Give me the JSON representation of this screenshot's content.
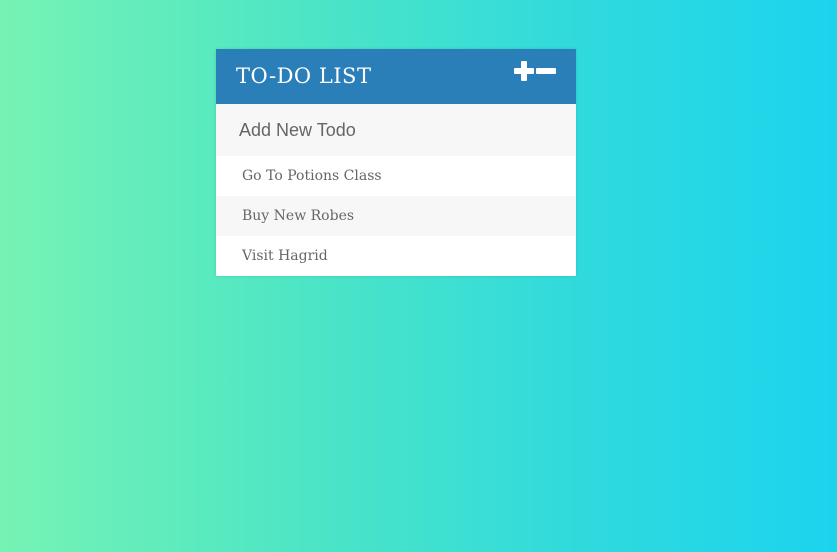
{
  "header": {
    "title": "TO-DO LIST",
    "toggle_icons": [
      "plus-icon",
      "minus-icon"
    ]
  },
  "new_todo": {
    "placeholder": "Add New Todo",
    "value": ""
  },
  "todos": [
    {
      "text": "Go To Potions Class"
    },
    {
      "text": "Buy New Robes"
    },
    {
      "text": "Visit Hagrid"
    }
  ],
  "colors": {
    "header_bg": "#2a7fb8",
    "gradient_start": "#76f3b4",
    "gradient_end": "#1cd3ee",
    "text": "#666666"
  }
}
